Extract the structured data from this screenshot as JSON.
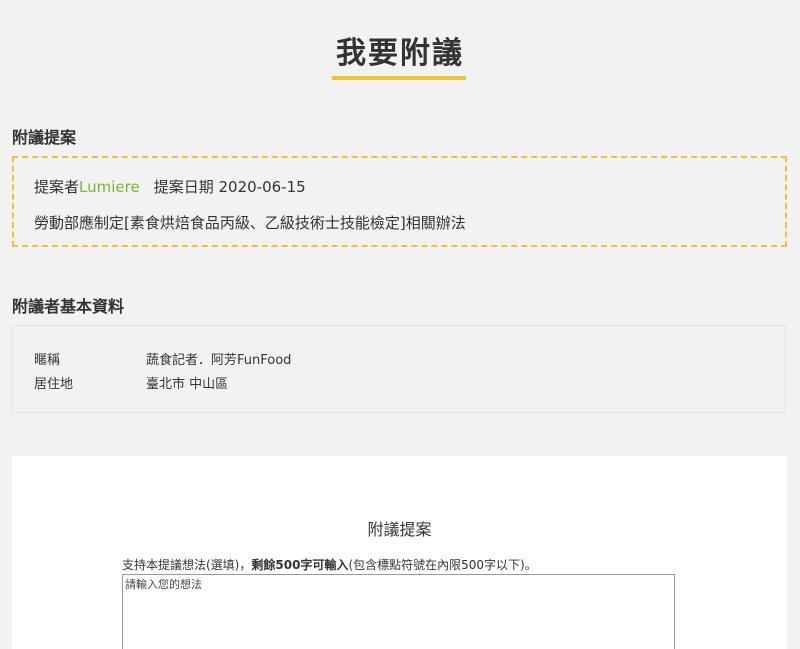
{
  "page": {
    "title": "我要附議"
  },
  "proposal_section": {
    "heading": "附議提案",
    "proposer_label": "提案者",
    "proposer_name": "Lumiere",
    "date_label": "提案日期",
    "date_value": "2020-06-15",
    "title": "勞動部應制定[素食烘焙食品丙級、乙級技術士技能檢定]相關辦法"
  },
  "seconder_section": {
    "heading": "附議者基本資料",
    "rows": [
      {
        "label": "暱稱",
        "value": "蔬食記者．阿芳FunFood"
      },
      {
        "label": "居住地",
        "value": "臺北市 中山區"
      }
    ]
  },
  "form": {
    "title": "附議提案",
    "hint_prefix": "支持本提議想法(選填)，",
    "hint_remaining": "剩餘500字可輸入",
    "hint_suffix": "(包含標點符號在內限500字以下)。",
    "textarea_placeholder": "請輸入您的想法",
    "textarea_value": ""
  },
  "colors": {
    "accent": "#f2c12e",
    "proposer_name": "#7cb82f",
    "background": "#f2f2f2"
  }
}
